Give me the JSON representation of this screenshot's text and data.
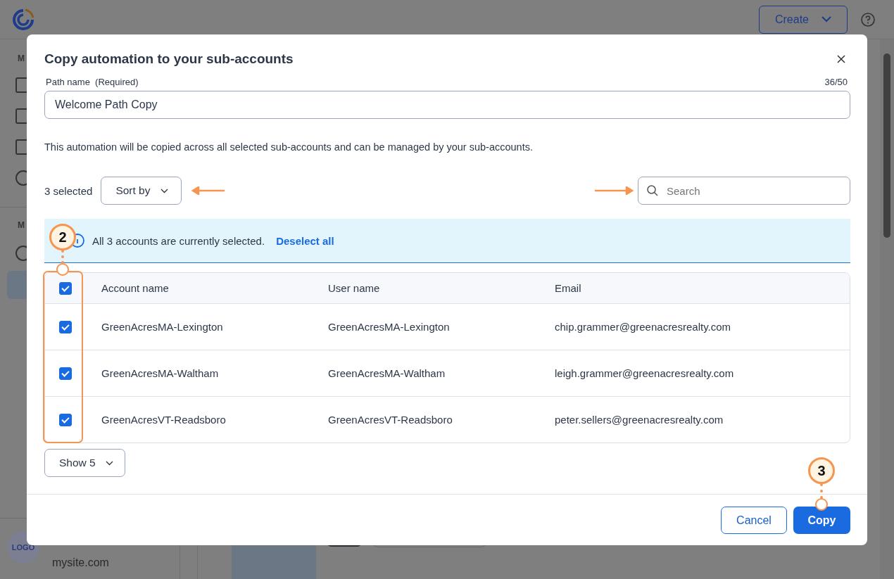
{
  "app": {
    "create_button": "Create",
    "sidebar": {
      "section_labels": [
        "M",
        "M"
      ],
      "account": {
        "logo": "LOGO",
        "site": "mysite.com"
      }
    }
  },
  "dialog": {
    "title": "Copy automation to your sub-accounts",
    "field": {
      "label": "Path name",
      "hint": "(Required)",
      "counter": "36/50",
      "value": "Welcome Path Copy"
    },
    "description": "This automation will be copied across all selected sub-accounts and can be managed by your sub-accounts.",
    "selected_count": "3 selected",
    "sort_button": "Sort by",
    "search": {
      "placeholder": "Search"
    },
    "banner": {
      "message": "All 3 accounts are currently selected.",
      "link": "Deselect all"
    },
    "table": {
      "all_checked": true,
      "columns": [
        "Account name",
        "User name",
        "Email"
      ],
      "rows": [
        {
          "checked": true,
          "cells": [
            "GreenAcresMA-Lexington",
            "GreenAcresMA-Lexington",
            "chip.grammer@greenacresrealty.com"
          ]
        },
        {
          "checked": true,
          "cells": [
            "GreenAcresMA-Waltham",
            "GreenAcresMA-Waltham",
            "leigh.grammer@greenacresrealty.com"
          ]
        },
        {
          "checked": true,
          "cells": [
            "GreenAcresVT-Readsboro",
            "GreenAcresVT-Readsboro",
            "peter.sellers@greenacresrealty.com"
          ]
        }
      ]
    },
    "page_size_button": "Show 5",
    "buttons": {
      "cancel": "Cancel",
      "copy": "Copy"
    }
  },
  "annotations": [
    {
      "label": "2"
    },
    {
      "label": "3"
    }
  ]
}
